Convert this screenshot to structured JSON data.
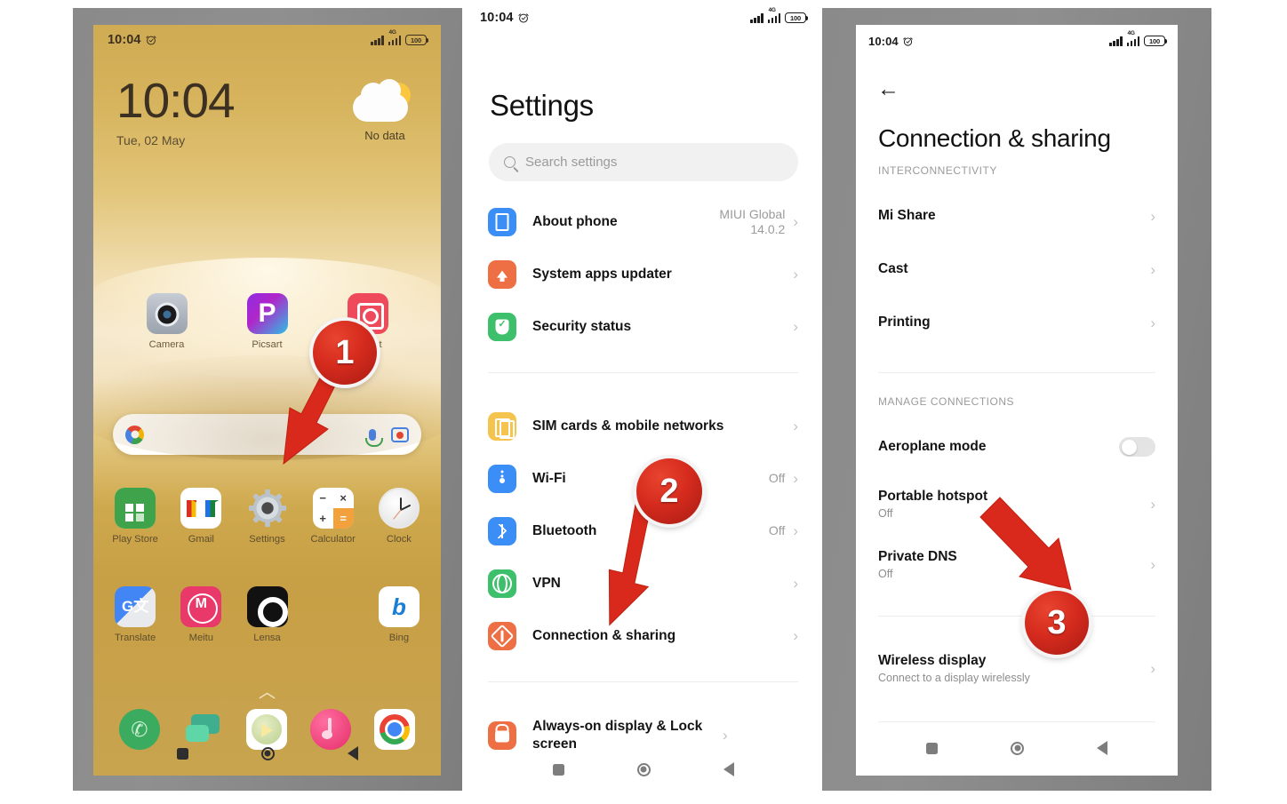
{
  "tutorial": {
    "steps": [
      {
        "number": "1",
        "target": "settings-app-icon"
      },
      {
        "number": "2",
        "target": "connection-and-sharing-row"
      },
      {
        "number": "3",
        "target": "portable-hotspot-row"
      }
    ],
    "accent_color": "#d52b1e",
    "frame_color": "#8a8a8a"
  },
  "phone1": {
    "status_bar": {
      "time": "10:04",
      "alarm_icon": "alarm-clock-icon",
      "network_label": "4G",
      "battery": "100"
    },
    "lockscreen": {
      "time": "10:04",
      "date": "Tue, 02 May"
    },
    "weather": {
      "icon": "sun-behind-cloud-icon",
      "text": "No data"
    },
    "folder_row": [
      {
        "label": "Camera",
        "icon": "camera-app-icon"
      },
      {
        "label": "Picsart",
        "icon": "picsart-app-icon"
      },
      {
        "label": "InShot",
        "icon": "inshot-app-icon"
      }
    ],
    "search_pill": {
      "logo": "google-g-icon",
      "mic": "microphone-icon",
      "lens": "google-lens-icon"
    },
    "apps_row1": [
      {
        "label": "Play Store",
        "icon": "play-store-icon"
      },
      {
        "label": "Gmail",
        "icon": "gmail-icon"
      },
      {
        "label": "Settings",
        "icon": "settings-gear-icon"
      },
      {
        "label": "Calculator",
        "icon": "calculator-icon"
      },
      {
        "label": "Clock",
        "icon": "clock-icon"
      }
    ],
    "apps_row2": [
      {
        "label": "Translate",
        "icon": "google-translate-icon"
      },
      {
        "label": "Meitu",
        "icon": "meitu-icon"
      },
      {
        "label": "Lensa",
        "icon": "lensa-icon"
      },
      {
        "label": "",
        "icon": "empty-slot"
      },
      {
        "label": "Bing",
        "icon": "bing-icon"
      }
    ],
    "page_indicator": "chevron-up-icon",
    "dock": [
      {
        "label": "",
        "icon": "phone-dialer-icon"
      },
      {
        "label": "",
        "icon": "messages-icon"
      },
      {
        "label": "",
        "icon": "mi-video-icon"
      },
      {
        "label": "",
        "icon": "music-icon"
      },
      {
        "label": "",
        "icon": "chrome-icon"
      }
    ],
    "nav": [
      "recents-square-icon",
      "home-circle-icon",
      "back-triangle-icon"
    ]
  },
  "phone2": {
    "status_bar": {
      "time": "10:04",
      "alarm_icon": "alarm-clock-icon",
      "network_label": "4G",
      "battery": "100"
    },
    "title": "Settings",
    "search": {
      "placeholder": "Search settings",
      "icon": "search-icon"
    },
    "group1": [
      {
        "icon": "about-phone-icon",
        "label": "About phone",
        "value": "MIUI Global\n14.0.2"
      },
      {
        "icon": "system-apps-updater-icon",
        "label": "System apps updater",
        "value": ""
      },
      {
        "icon": "security-status-icon",
        "label": "Security status",
        "value": ""
      }
    ],
    "group2": [
      {
        "icon": "sim-cards-icon",
        "label": "SIM cards & mobile networks",
        "value": ""
      },
      {
        "icon": "wifi-icon",
        "label": "Wi-Fi",
        "value": "Off"
      },
      {
        "icon": "bluetooth-icon",
        "label": "Bluetooth",
        "value": "Off"
      },
      {
        "icon": "vpn-icon",
        "label": "VPN",
        "value": ""
      },
      {
        "icon": "connection-sharing-icon",
        "label": "Connection & sharing",
        "value": ""
      }
    ],
    "group3": [
      {
        "icon": "always-on-display-icon",
        "label": "Always-on display & Lock screen",
        "value": ""
      }
    ],
    "nav": [
      "recents-square-icon",
      "home-circle-icon",
      "back-triangle-icon"
    ]
  },
  "phone3": {
    "status_bar": {
      "time": "10:04",
      "alarm_icon": "alarm-clock-icon",
      "network_label": "4G",
      "battery": "100"
    },
    "back_icon": "back-arrow-icon",
    "title": "Connection & sharing",
    "section1": {
      "header": "INTERCONNECTIVITY",
      "items": [
        {
          "label": "Mi Share",
          "sub": "",
          "control": "chevron"
        },
        {
          "label": "Cast",
          "sub": "",
          "control": "chevron"
        },
        {
          "label": "Printing",
          "sub": "",
          "control": "chevron"
        }
      ]
    },
    "section2": {
      "header": "MANAGE CONNECTIONS",
      "items": [
        {
          "label": "Aeroplane mode",
          "sub": "",
          "control": "toggle-off"
        },
        {
          "label": "Portable hotspot",
          "sub": "Off",
          "control": "chevron"
        },
        {
          "label": "Private DNS",
          "sub": "Off",
          "control": "chevron"
        }
      ]
    },
    "section3": {
      "items": [
        {
          "label": "Wireless display",
          "sub": "Connect to a display wirelessly",
          "control": "chevron"
        }
      ]
    },
    "nav": [
      "recents-square-icon",
      "home-circle-icon",
      "back-triangle-icon"
    ]
  }
}
